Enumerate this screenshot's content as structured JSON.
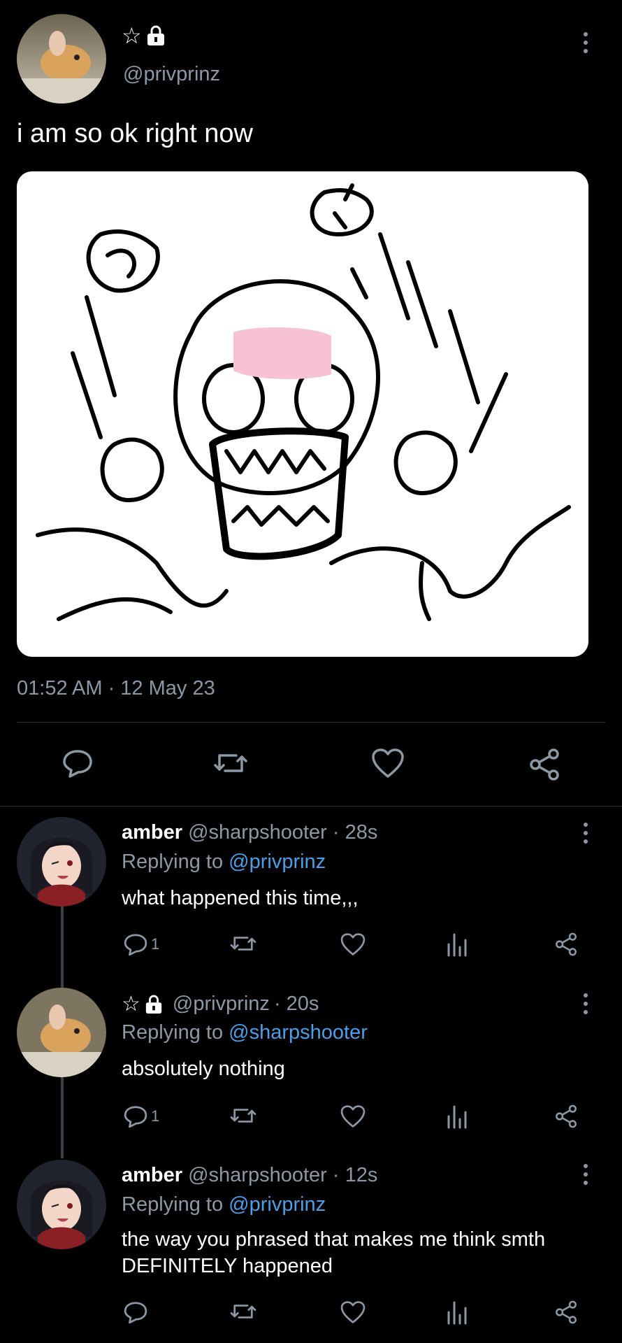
{
  "tweet": {
    "badges": "☆",
    "handle": "@privprinz",
    "text": "i am so ok right now",
    "timestamp": "01:52 AM · 12 May 23",
    "avatar_icon": "hamster-avatar",
    "image_icon": "scribble-face-drawing"
  },
  "replies": [
    {
      "name": "amber",
      "handle": "@sharpshooter",
      "age": "· 28s",
      "replying_prefix": "Replying to",
      "replying_to": "@privprinz",
      "text_lines": [
        "what happened this time,,,"
      ],
      "reply_count": "1",
      "avatar_icon": "anime-girl-avatar"
    },
    {
      "name": "",
      "badges": "☆",
      "handle": "@privprinz",
      "age": "· 20s",
      "replying_prefix": "Replying to",
      "replying_to": "@sharpshooter",
      "text_lines": [
        "absolutely nothing"
      ],
      "reply_count": "1",
      "avatar_icon": "hamster-avatar"
    },
    {
      "name": "amber",
      "handle": "@sharpshooter",
      "age": "· 12s",
      "replying_prefix": "Replying to",
      "replying_to": "@privprinz",
      "text_lines": [
        "the way you phrased that makes me think smth",
        "DEFINITELY happened"
      ],
      "reply_count": "",
      "avatar_icon": "anime-girl-avatar"
    }
  ],
  "colors": {
    "background": "#000000",
    "muted": "#8b98a5",
    "link": "#4a9fe8",
    "divider": "#2f3336"
  }
}
